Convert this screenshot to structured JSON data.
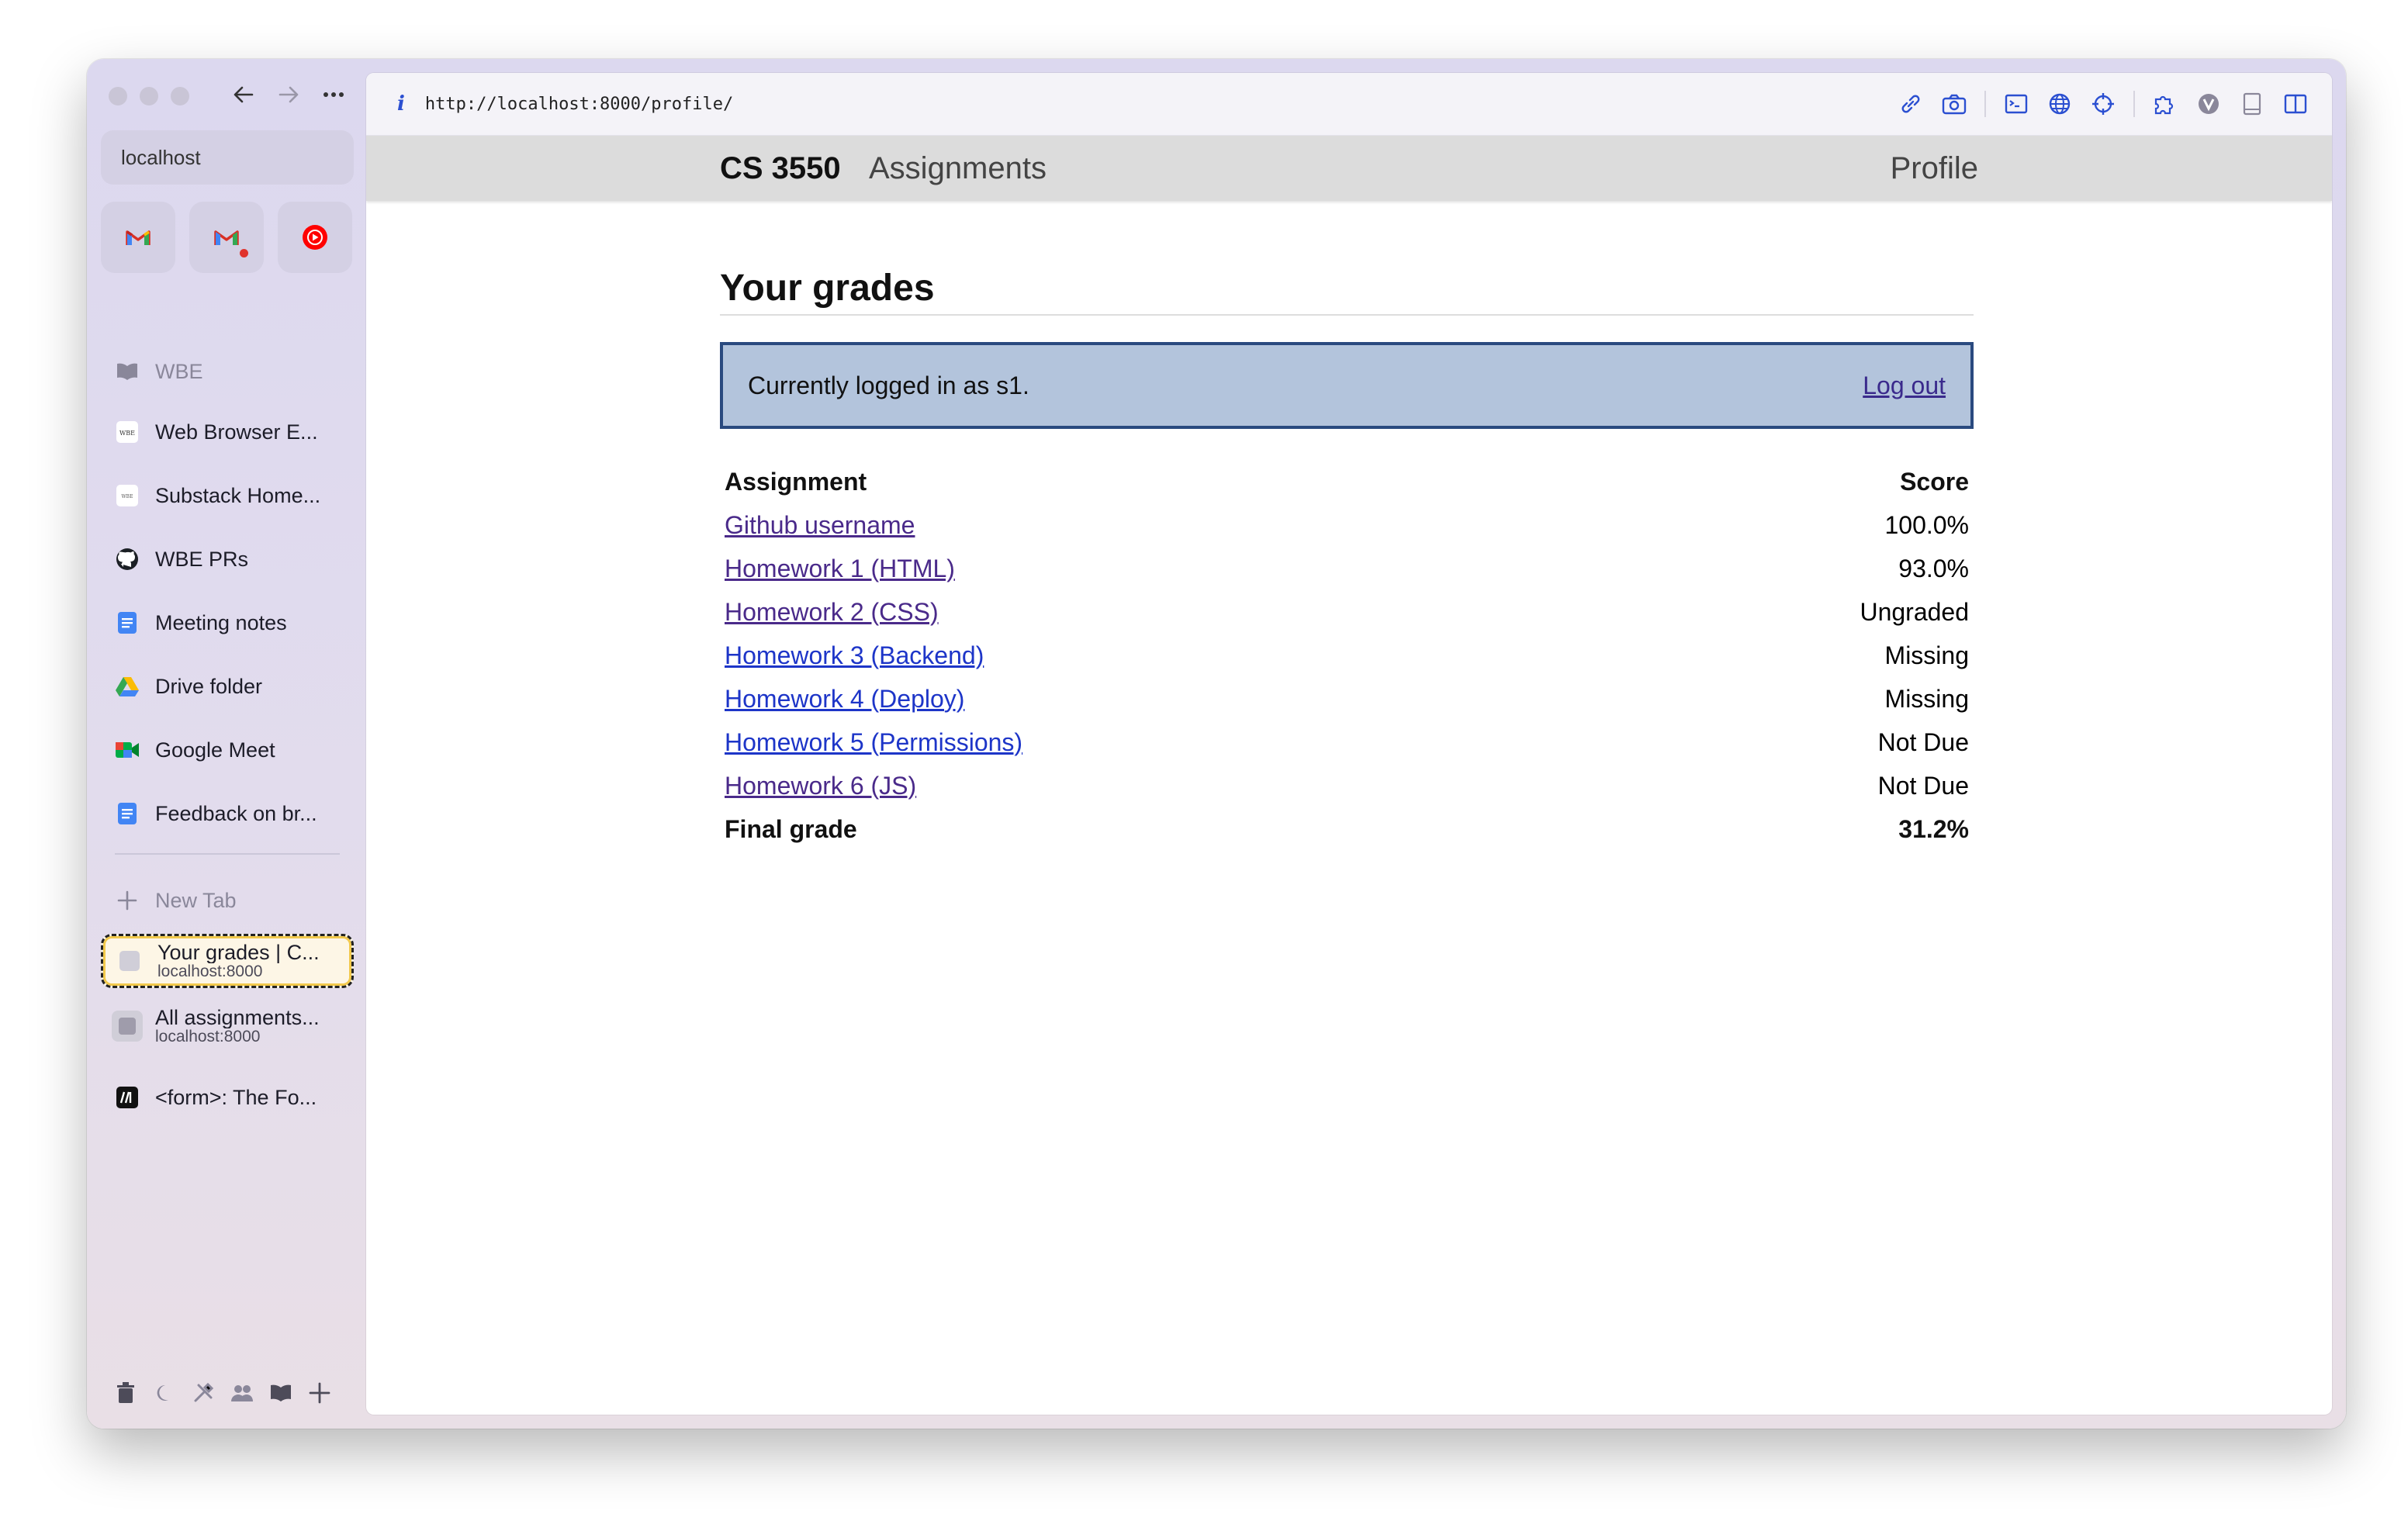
{
  "browser": {
    "sidebar_url": "localhost",
    "address": "http://localhost:8000/profile/",
    "info_glyph": "i",
    "pinned": [
      {
        "icon": "gmail-icon"
      },
      {
        "icon": "gmail-icon",
        "has_notification": true
      },
      {
        "icon": "youtube-music-icon"
      }
    ],
    "folder": "WBE",
    "tabs": [
      {
        "label": "Web Browser E...",
        "icon": "wbe-icon"
      },
      {
        "label": "Substack Home...",
        "icon": "wbe-icon"
      },
      {
        "label": "WBE PRs",
        "icon": "github-icon"
      },
      {
        "label": "Meeting notes",
        "icon": "docs-icon"
      },
      {
        "label": "Drive folder",
        "icon": "drive-icon"
      },
      {
        "label": "Google Meet",
        "icon": "meet-icon"
      },
      {
        "label": "Feedback on br...",
        "icon": "docs-icon"
      }
    ],
    "new_tab": "New Tab",
    "open_tabs": [
      {
        "title": "Your grades | C...",
        "sub": "localhost:8000",
        "active": true
      },
      {
        "title": "All assignments...",
        "sub": "localhost:8000",
        "active": false
      },
      {
        "title": "<form>: The Fo...",
        "icon": "mdn-icon"
      }
    ]
  },
  "site": {
    "brand": "CS 3550",
    "nav_assignments": "Assignments",
    "nav_profile": "Profile"
  },
  "page": {
    "heading": "Your grades",
    "login_text": "Currently logged in as s1.",
    "logout": "Log out",
    "col_assignment": "Assignment",
    "col_score": "Score",
    "rows": [
      {
        "name": "Github username",
        "score": "100.0%",
        "visited": true
      },
      {
        "name": "Homework 1 (HTML)",
        "score": "93.0%",
        "visited": true
      },
      {
        "name": "Homework 2 (CSS)",
        "score": "Ungraded",
        "visited": true
      },
      {
        "name": "Homework 3 (Backend)",
        "score": "Missing",
        "visited": false
      },
      {
        "name": "Homework 4 (Deploy)",
        "score": "Missing",
        "visited": false
      },
      {
        "name": "Homework 5 (Permissions)",
        "score": "Not Due",
        "visited": false
      },
      {
        "name": "Homework 6 (JS)",
        "score": "Not Due",
        "visited": true
      }
    ],
    "final_label": "Final grade",
    "final_score": "31.2%"
  },
  "colors": {
    "login_bg": "#b3c4dc",
    "login_border": "#2a4a7f",
    "link": "#1d35c8",
    "link_visited": "#4a2a8a",
    "header_bg": "#dcdcdc"
  }
}
